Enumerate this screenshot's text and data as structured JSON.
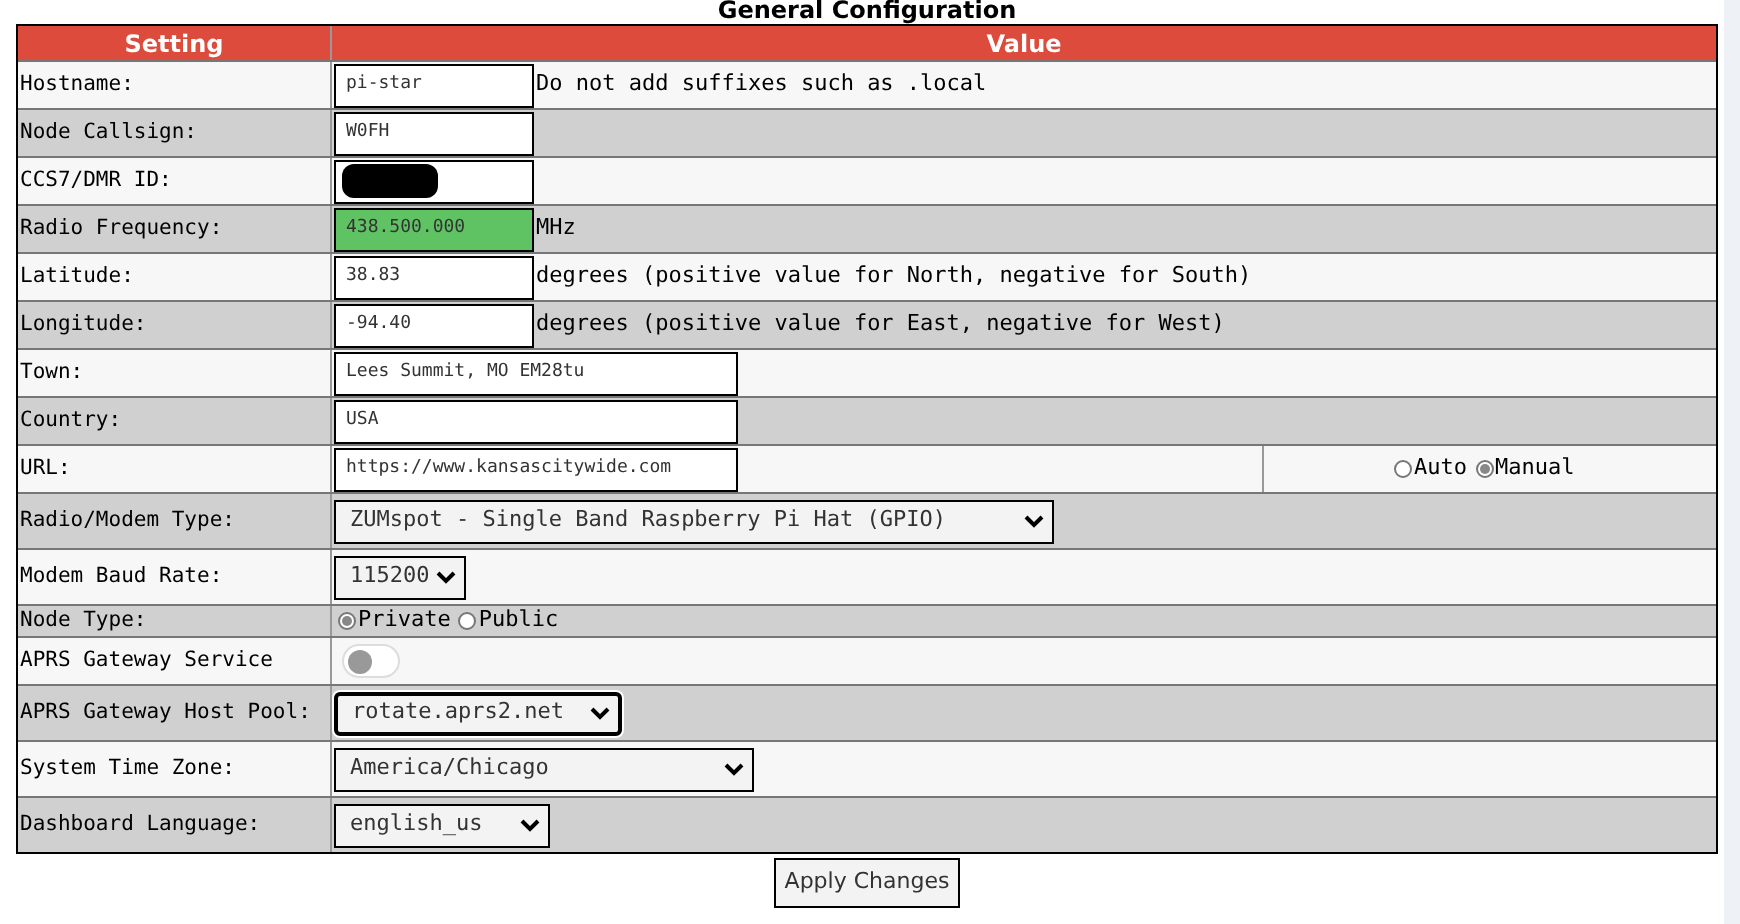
{
  "title": "General Configuration",
  "columns": [
    "Setting",
    "Value"
  ],
  "rows": [
    {
      "kind": "field",
      "label": "Hostname:",
      "value": "pi-star",
      "note": "Do not add suffixes such as .local",
      "highlighted": false,
      "redacted": false
    },
    {
      "kind": "field",
      "label": "Node Callsign:",
      "value": "W0FH",
      "highlighted": false,
      "redacted": false
    },
    {
      "kind": "field",
      "label": "CCS7/DMR ID:",
      "highlighted": false,
      "redacted": true
    },
    {
      "kind": "field",
      "label": "Radio Frequency:",
      "value": "438.500.000",
      "note": "MHz",
      "highlighted": true,
      "redacted": false
    },
    {
      "kind": "field",
      "label": "Latitude:",
      "value": "38.83",
      "note": "degrees (positive value for North, negative for South)",
      "highlighted": false,
      "redacted": false
    },
    {
      "kind": "field",
      "label": "Longitude:",
      "value": "-94.40",
      "note": "degrees (positive value for East, negative for West)",
      "highlighted": false,
      "redacted": false
    },
    {
      "kind": "wide_field",
      "label": "Town:",
      "value": "Lees Summit, MO EM28tu",
      "highlighted": false,
      "redacted": false
    },
    {
      "kind": "wide_field",
      "label": "Country:",
      "value": "USA",
      "highlighted": false,
      "redacted": false
    },
    {
      "kind": "wide_field",
      "label": "URL:",
      "value": "https://www.kansascitywide.com",
      "highlighted": false,
      "redacted": false,
      "options": [
        {
          "label": "Auto",
          "selected": false
        },
        {
          "label": "Manual",
          "selected": true
        }
      ]
    },
    {
      "kind": "select",
      "label": "Radio/Modem Type:",
      "value": "ZUMspot - Single Band Raspberry Pi Hat (GPIO)",
      "focused": false
    },
    {
      "kind": "select",
      "label": "Modem Baud Rate:",
      "value": "115200",
      "focused": false
    },
    {
      "kind": "radio",
      "label": "Node Type:",
      "options": [
        {
          "label": "Private",
          "selected": true
        },
        {
          "label": "Public",
          "selected": false
        }
      ]
    },
    {
      "kind": "toggle",
      "label": "APRS Gateway Service",
      "on": false
    },
    {
      "kind": "select",
      "label": "APRS Gateway Host Pool:",
      "value": "rotate.aprs2.net",
      "focused": true
    },
    {
      "kind": "select",
      "label": "System Time Zone:",
      "value": "America/Chicago",
      "focused": false
    },
    {
      "kind": "select",
      "label": "Dashboard Language:",
      "value": "english_us",
      "focused": false
    }
  ],
  "button": "Apply Changes"
}
